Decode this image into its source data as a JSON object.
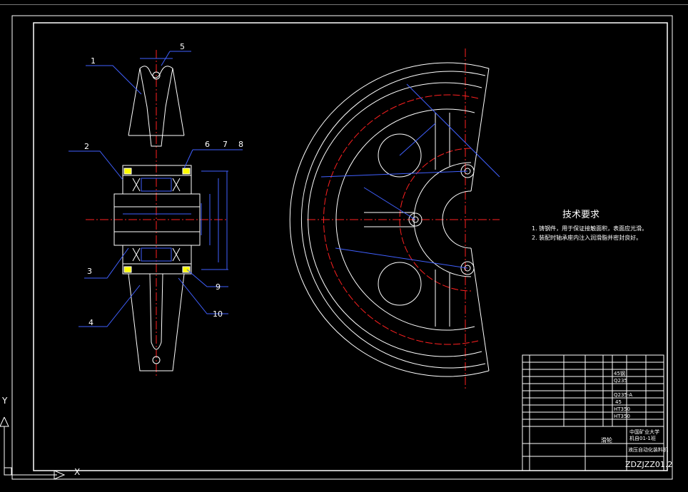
{
  "colors": {
    "background": "#000000",
    "outline": "#ffffff",
    "dimension": "#4060ff",
    "centerline": "#ff2020",
    "leader": "#4060ff",
    "fill": "#ffff00"
  },
  "part_numbers": [
    "1",
    "2",
    "3",
    "4",
    "5",
    "6",
    "7",
    "8",
    "9",
    "10"
  ],
  "technical_requirements": {
    "title": "技术要求",
    "items": [
      "1. 铸钢件，用于保证接触面积，表面应光滑。",
      "2. 装配时轴承座内注入润滑脂并密封良好。"
    ]
  },
  "title_block": {
    "part_name": "滑轮",
    "school": "中国矿业大学",
    "class": "机自01-1班",
    "drawing_title": "液压自动化装料机",
    "drawing_code": "ZDZJZZ01.2",
    "materials": [
      "45钢",
      "Q235",
      "Q235-A",
      "45",
      "HT350",
      "HT350"
    ]
  },
  "ucs": {
    "y_label": "Y",
    "x_label": "X"
  }
}
